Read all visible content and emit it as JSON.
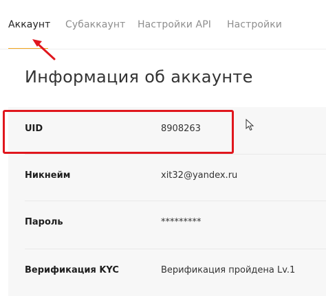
{
  "tabs": [
    {
      "label": "Аккаунт",
      "active": true
    },
    {
      "label": "Субаккаунт",
      "active": false
    },
    {
      "label": "Настройки API",
      "active": false
    },
    {
      "label": "Настройки",
      "active": false
    }
  ],
  "page": {
    "title": "Информация об аккаунте"
  },
  "account_info": [
    {
      "label": "UID",
      "value": "8908263"
    },
    {
      "label": "Никнейм",
      "value": "xit32@yandex.ru"
    },
    {
      "label": "Пароль",
      "value": "*********"
    },
    {
      "label": "Верификация KYC",
      "value": "Верификация пройдена Lv.1"
    }
  ],
  "colors": {
    "accent": "#f3a61c",
    "annotation": "#e0161d",
    "panel_bg": "#f7f7f7"
  },
  "icons": [
    "arrow-annotation-icon",
    "mouse-cursor-icon"
  ]
}
